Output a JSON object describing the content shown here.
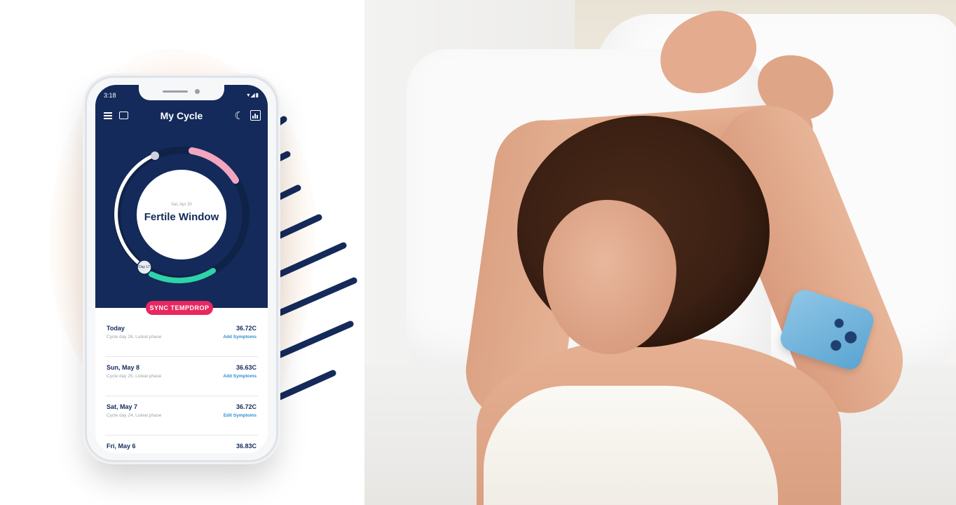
{
  "phone": {
    "status_time": "3:18",
    "status_icons": "◂ ◎",
    "status_right": "▾◢▮",
    "header": {
      "title": "My Cycle"
    },
    "ring": {
      "date": "Sat, Apr 30",
      "label": "Fertile Window",
      "marker": "Day 17"
    },
    "sync_button": "SYNC TEMPDROP",
    "entries": [
      {
        "date": "Today",
        "temp": "36.72C",
        "subtitle": "Cycle day 26, Luteal phase",
        "action": "Add Symptoms"
      },
      {
        "date": "Sun, May 8",
        "temp": "36.63C",
        "subtitle": "Cycle day 25, Luteal phase",
        "action": "Add Symptoms"
      },
      {
        "date": "Sat, May 7",
        "temp": "36.72C",
        "subtitle": "Cycle day 24, Luteal phase",
        "action": "Edit Symptoms"
      },
      {
        "date": "Fri, May 6",
        "temp": "36.83C",
        "subtitle": "",
        "action": ""
      }
    ]
  },
  "colors": {
    "navy": "#142a5a",
    "pink": "#e9275f",
    "teal": "#2fd3a9",
    "link": "#2e8fd3"
  },
  "icons": [
    "menu-icon",
    "chat-icon",
    "moon-icon",
    "chart-icon"
  ]
}
